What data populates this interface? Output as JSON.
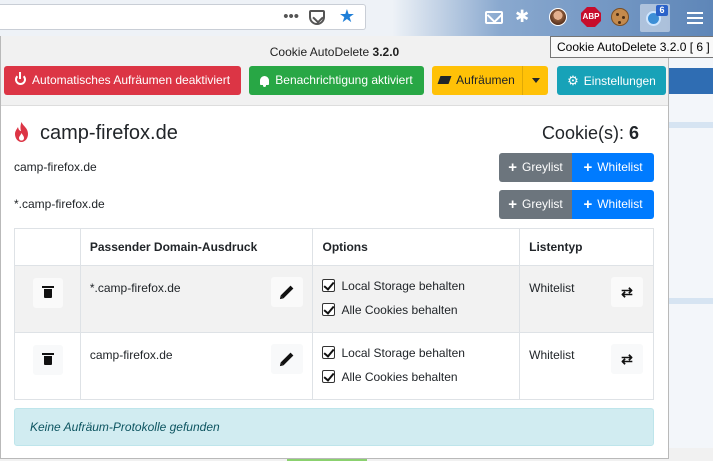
{
  "browser": {
    "toolbar_dots": "•••",
    "extension_badge": "6",
    "abp_label": "ABP",
    "tooltip": "Cookie AutoDelete 3.2.0   [ 6 ]"
  },
  "popup": {
    "title_name": "Cookie AutoDelete",
    "title_version": "3.2.0",
    "buttons": {
      "auto_clean": "Automatisches Aufräumen deaktiviert",
      "notifications": "Benachrichtigung aktiviert",
      "clean": "Aufräumen",
      "settings": "Einstellungen"
    },
    "domain": "camp-firefox.de",
    "cookie_count_label": "Cookie(s):",
    "cookie_count": "6",
    "list_rows": [
      {
        "label": "camp-firefox.de",
        "greylist": "Greylist",
        "whitelist": "Whitelist"
      },
      {
        "label": "*.camp-firefox.de",
        "greylist": "Greylist",
        "whitelist": "Whitelist"
      }
    ],
    "table": {
      "headers": [
        "",
        "Passender Domain-Ausdruck",
        "Options",
        "Listentyp"
      ],
      "rows": [
        {
          "expression": "*.camp-firefox.de",
          "option1": "Local Storage behalten",
          "option2": "Alle Cookies behalten",
          "list_type": "Whitelist"
        },
        {
          "expression": "camp-firefox.de",
          "option1": "Local Storage behalten",
          "option2": "Alle Cookies behalten",
          "list_type": "Whitelist"
        }
      ]
    },
    "alert": "Keine Aufräum-Protokolle gefunden"
  }
}
